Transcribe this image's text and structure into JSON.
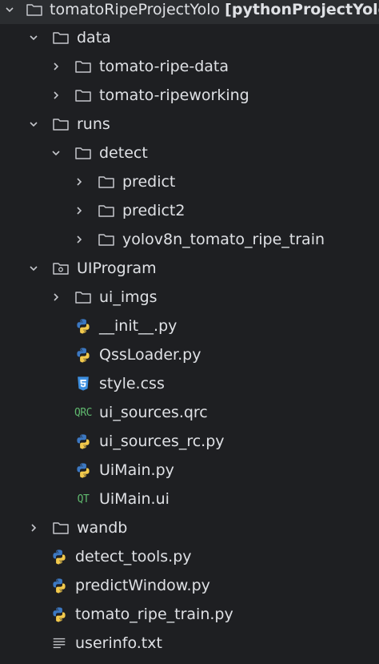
{
  "root": {
    "name": "tomatoRipeProjectYolo",
    "project": "[pythonProjectYolo]"
  },
  "items": [
    {
      "label": "data"
    },
    {
      "label": "tomato-ripe-data"
    },
    {
      "label": "tomato-ripeworking"
    },
    {
      "label": "runs"
    },
    {
      "label": "detect"
    },
    {
      "label": "predict"
    },
    {
      "label": "predict2"
    },
    {
      "label": "yolov8n_tomato_ripe_train"
    },
    {
      "label": "UIProgram"
    },
    {
      "label": "ui_imgs"
    },
    {
      "label": "__init__.py"
    },
    {
      "label": "QssLoader.py"
    },
    {
      "label": "style.css"
    },
    {
      "label": "ui_sources.qrc"
    },
    {
      "label": "ui_sources_rc.py"
    },
    {
      "label": "UiMain.py"
    },
    {
      "label": "UiMain.ui"
    },
    {
      "label": "wandb"
    },
    {
      "label": "detect_tools.py"
    },
    {
      "label": "predictWindow.py"
    },
    {
      "label": "tomato_ripe_train.py"
    },
    {
      "label": "userinfo.txt"
    }
  ],
  "icon_labels": {
    "qrc": "QRC",
    "qt": "QT"
  },
  "colors": {
    "background": "#1e1f22",
    "selection": "#2b2d30",
    "text": "#dfe1e5",
    "python_blue": "#3c78c2",
    "python_yellow": "#f2c94c",
    "css_blue": "#3d8fe0",
    "qt_green": "#5fb86e"
  }
}
